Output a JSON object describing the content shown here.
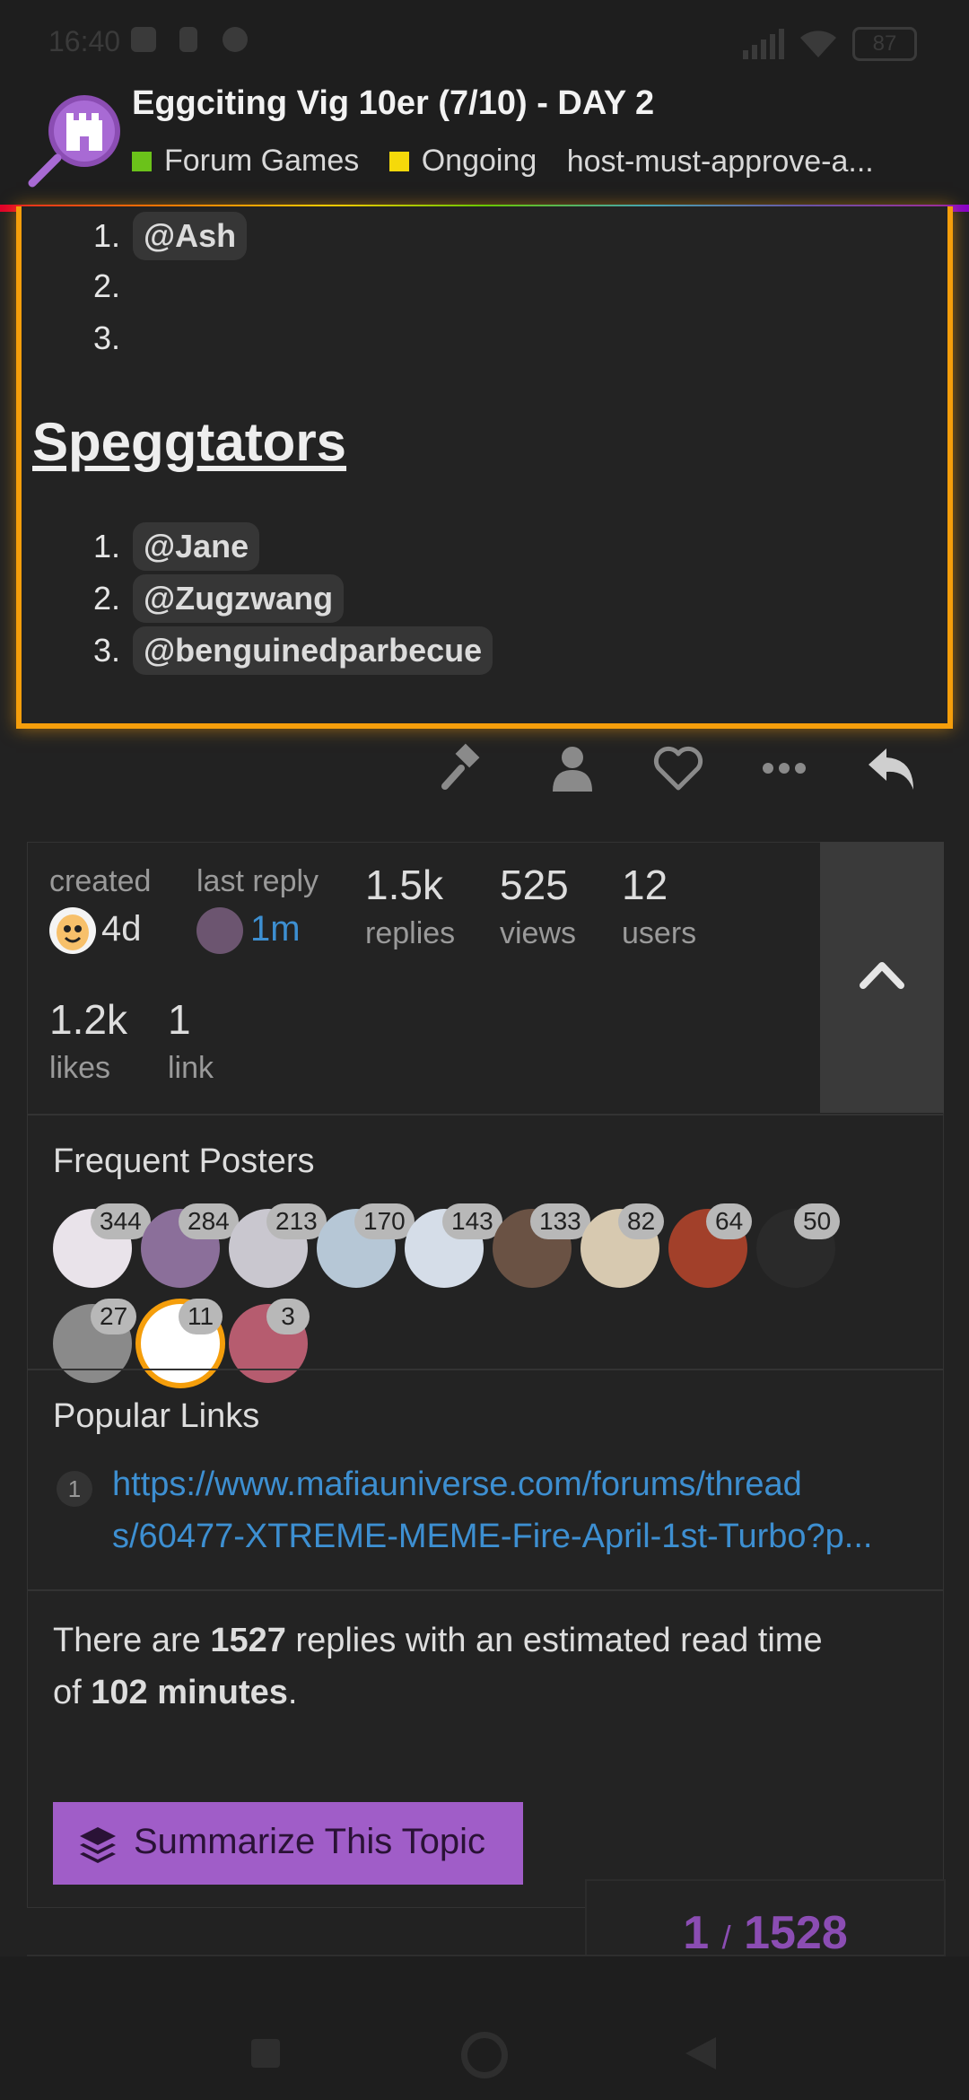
{
  "status_bar": {
    "time": "16:40",
    "battery": "87"
  },
  "header": {
    "title": "Eggciting Vig 10er (7/10) - DAY 2",
    "categories": [
      {
        "label": "Forum Games",
        "color": "#6bc21a"
      },
      {
        "label": "Ongoing",
        "color": "#f5d90a"
      }
    ],
    "tag": "host-must-approve-a..."
  },
  "post": {
    "list_top": [
      {
        "num": "1.",
        "mention": "@Ash"
      },
      {
        "num": "2.",
        "mention": ""
      },
      {
        "num": "3.",
        "mention": ""
      }
    ],
    "heading": "Speggtators",
    "spectators": [
      {
        "num": "1.",
        "mention": "@Jane"
      },
      {
        "num": "2.",
        "mention": "@Zugzwang"
      },
      {
        "num": "3.",
        "mention": "@benguinedparbecue"
      }
    ]
  },
  "actions": [
    "gavel-icon",
    "user-icon",
    "heart-icon",
    "more-icon",
    "reply-icon"
  ],
  "topic_map": {
    "created_label": "created",
    "created_value": "4d",
    "last_reply_label": "last reply",
    "last_reply_value": "1m",
    "replies_value": "1.5k",
    "replies_label": "replies",
    "views_value": "525",
    "views_label": "views",
    "users_value": "12",
    "users_label": "users",
    "likes_value": "1.2k",
    "likes_label": "likes",
    "links_value": "1",
    "links_label": "link",
    "frequent_title": "Frequent Posters",
    "posters": [
      "344",
      "284",
      "213",
      "170",
      "143",
      "133",
      "82",
      "64",
      "50",
      "27",
      "11",
      "3"
    ],
    "popular_title": "Popular Links",
    "link_count": "1",
    "link_line1": "https://www.mafiauniverse.com/forums/thread",
    "link_line2": "s/60477-XTREME-MEME-Fire-April-1st-Turbo?p...",
    "summary_pre": "There are ",
    "summary_replies": "1527",
    "summary_mid": " replies with an estimated read time",
    "summary_of": "of ",
    "summary_minutes": "102 minutes",
    "summary_end": ".",
    "summarize_label": "Summarize This Topic"
  },
  "progress": {
    "current": "1",
    "sep": "/",
    "total": "1528"
  },
  "colors": {
    "accent": "#a05dc8",
    "highlight": "#f59e0b",
    "link": "#3d8fd1"
  }
}
